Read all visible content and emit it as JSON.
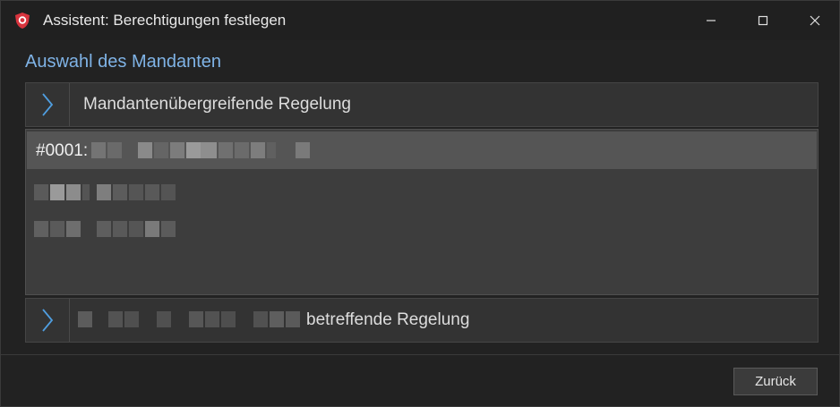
{
  "window": {
    "title": "Assistent: Berechtigungen festlegen",
    "icon": "shield-icon",
    "controls": [
      "minimize-icon",
      "maximize-icon",
      "close-icon"
    ]
  },
  "section": {
    "heading": "Auswahl des Mandanten"
  },
  "expanders": {
    "cross_client": {
      "label": "Mandantenübergreifende Regelung",
      "icon": "chevron-right-icon"
    },
    "client_specific": {
      "label": "betreffende Regelung",
      "icon": "chevron-right-icon"
    }
  },
  "client_list": {
    "items": [
      {
        "prefix": "#0001:",
        "selected": true
      },
      {
        "prefix": "",
        "selected": false
      },
      {
        "prefix": "",
        "selected": false
      }
    ]
  },
  "footer": {
    "back_label": "Zurück"
  },
  "colors": {
    "accent_heading": "#7fb3e6",
    "chevron": "#4f9ee0",
    "icon_red": "#d8343e",
    "selected_row": "#555555"
  }
}
